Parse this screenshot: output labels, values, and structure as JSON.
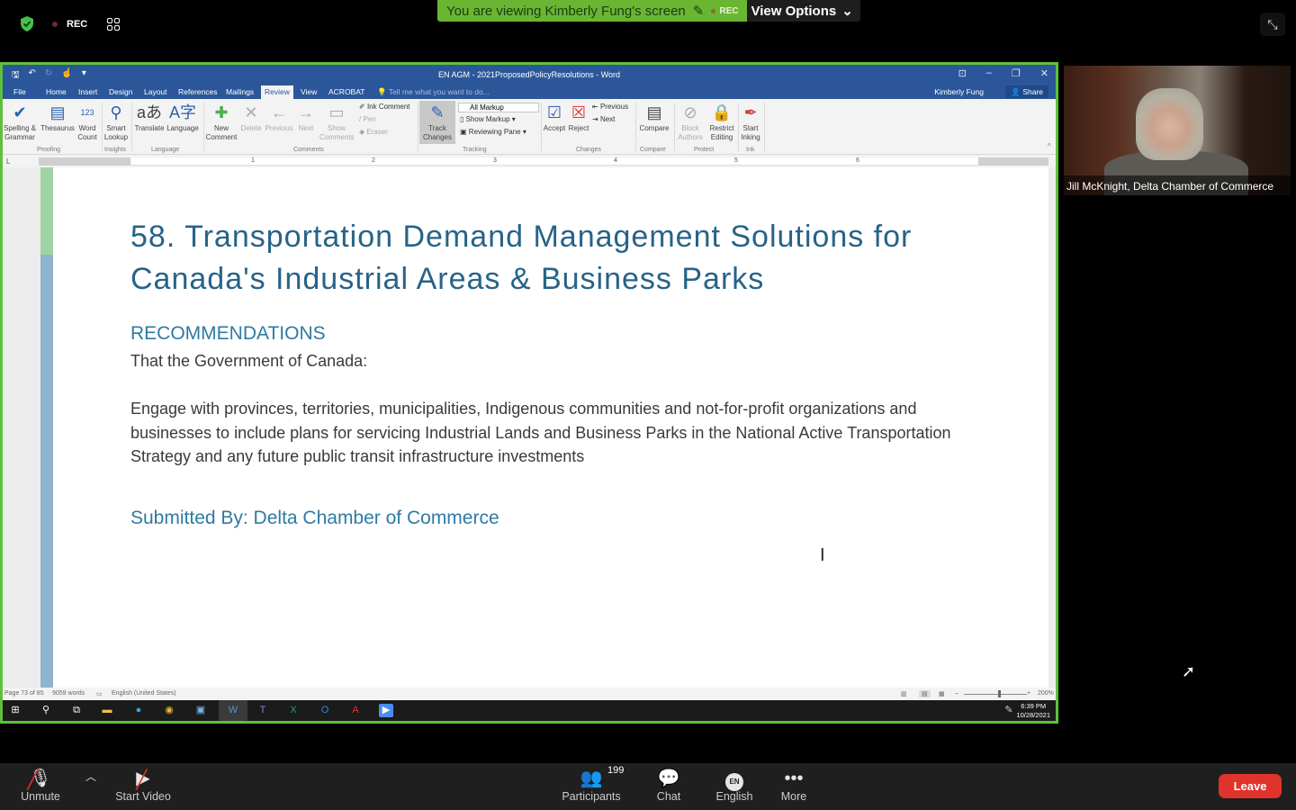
{
  "zoom": {
    "rec_label": "REC",
    "banner_text": "You are viewing Kimberly Fung's screen",
    "banner_rec": "REC",
    "view_options": "View Options",
    "colors": {
      "share_border": "#5ec13b",
      "banner": "#6ab633",
      "leave": "#e0332b"
    },
    "video": {
      "participant_name": "Jill McKnight, Delta Chamber of Commerce"
    },
    "toolbar": {
      "unmute": "Unmute",
      "start_video": "Start Video",
      "participants": "Participants",
      "participants_count": "199",
      "chat": "Chat",
      "language": "English",
      "language_badge": "EN",
      "more": "More",
      "leave": "Leave"
    }
  },
  "word": {
    "window_title": "EN AGM - 2021ProposedPolicyResolutions - Word",
    "tabs": [
      "File",
      "Home",
      "Insert",
      "Design",
      "Layout",
      "References",
      "Mailings",
      "Review",
      "View",
      "ACROBAT"
    ],
    "active_tab": "Review",
    "tell_me": "Tell me what you want to do...",
    "user": "Kimberly Fung",
    "share": "Share",
    "ribbon": {
      "spelling": "Spelling &",
      "grammar": "Grammar",
      "thesaurus": "Thesaurus",
      "word": "Word",
      "count": "Count",
      "smart": "Smart",
      "lookup": "Lookup",
      "translate": "Translate",
      "language": "Language",
      "new": "New",
      "comment": "Comment",
      "delete": "Delete",
      "previous": "Previous",
      "next": "Next",
      "show": "Show",
      "comments": "Comments",
      "ink_comment": "Ink Comment",
      "pen": "Pen",
      "eraser": "Eraser",
      "track": "Track",
      "changes": "Changes",
      "all_markup": "All Markup",
      "show_markup": "Show Markup",
      "reviewing_pane": "Reviewing Pane",
      "accept": "Accept",
      "reject": "Reject",
      "prev_change": "Previous",
      "next_change": "Next",
      "compare": "Compare",
      "block": "Block",
      "authors": "Authors",
      "restrict": "Restrict",
      "editing": "Editing",
      "start": "Start",
      "inking": "Inking",
      "groups": [
        "Proofing",
        "Insights",
        "Language",
        "Comments",
        "Tracking",
        "Changes",
        "Compare",
        "Protect",
        "Ink"
      ]
    },
    "ruler_numbers": [
      "1",
      "2",
      "3",
      "4",
      "5",
      "6"
    ],
    "document": {
      "heading": "58. Transportation Demand Management Solutions for Canada's Industrial Areas & Business Parks",
      "section": "RECOMMENDATIONS",
      "lead": "That the Government of Canada:",
      "paragraph": "Engage with provinces, territories, municipalities, Indigenous communities and not-for-profit organizations and businesses to include plans for servicing Industrial Lands and Business Parks in the National Active Transportation Strategy and any future public transit infrastructure investments",
      "submitted": "Submitted By: Delta Chamber of Commerce"
    },
    "status": {
      "page": "Page 73 of 85",
      "words": "9059 words",
      "language": "English (United States)",
      "zoom": "200%"
    },
    "taskbar": {
      "time": "6:39 PM",
      "date": "10/28/2021"
    }
  }
}
